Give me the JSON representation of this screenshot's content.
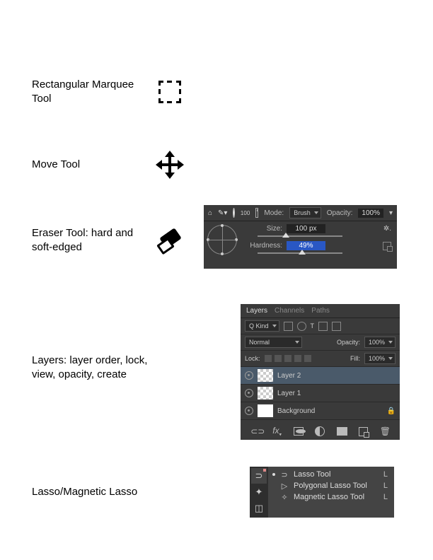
{
  "items": {
    "marquee": {
      "label": "Rectangular Marquee Tool"
    },
    "move": {
      "label": "Move Tool"
    },
    "eraser": {
      "label": "Eraser Tool: hard and soft-edged"
    },
    "layers": {
      "label": "Layers: layer order, lock, view, opacity, create"
    },
    "lasso": {
      "label": "Lasso/Magnetic Lasso"
    }
  },
  "eraser_panel": {
    "count_label": "100",
    "mode_label": "Mode:",
    "mode_value": "Brush",
    "opacity_label": "Opacity:",
    "opacity_value": "100%",
    "size_label": "Size:",
    "size_value": "100 px",
    "hardness_label": "Hardness:",
    "hardness_value": "49%"
  },
  "layers_panel": {
    "tabs": [
      "Layers",
      "Channels",
      "Paths"
    ],
    "filter_label": "Q Kind",
    "blend_mode": "Normal",
    "opacity_label": "Opacity:",
    "opacity_value": "100%",
    "lock_label": "Lock:",
    "fill_label": "Fill:",
    "fill_value": "100%",
    "layer_names": [
      "Layer 2",
      "Layer 1",
      "Background"
    ]
  },
  "lasso_panel": {
    "options": [
      {
        "name": "Lasso Tool",
        "shortcut": "L",
        "active": true
      },
      {
        "name": "Polygonal Lasso Tool",
        "shortcut": "L",
        "active": false
      },
      {
        "name": "Magnetic Lasso Tool",
        "shortcut": "L",
        "active": false
      }
    ]
  }
}
